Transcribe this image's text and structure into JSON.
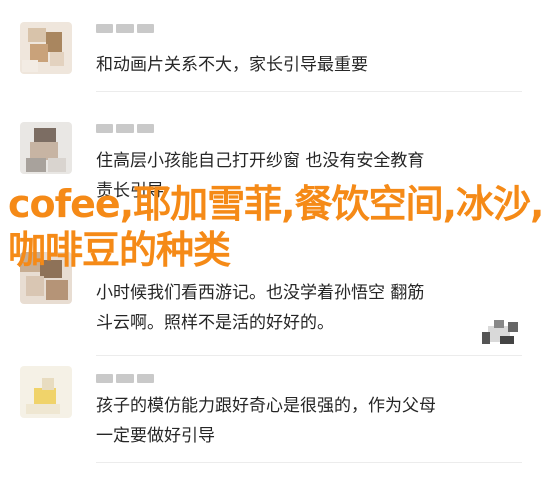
{
  "comments": [
    {
      "username_mask": "███",
      "lines": [
        "和动画片关系不大，家长引导最重要"
      ]
    },
    {
      "username_mask": "███",
      "lines": [
        "住高层小孩能自己打开纱窗 也没有安全教育",
        "责长引导"
      ]
    },
    {
      "username_mask": "███",
      "lines": [
        "小时候我们看西游记。也没学着孙悟空  翻筋",
        "斗云啊。照样不是活的好好的。"
      ]
    },
    {
      "username_mask": "███",
      "lines": [
        "孩子的模仿能力跟好奇心是很强的，作为父母",
        "一定要做好引导"
      ]
    }
  ],
  "overlay": {
    "title": "cofee,耶加雪菲,餐饮空间,冰沙,咖啡豆的种类"
  },
  "colors": {
    "overlay": "#f58a17",
    "divider": "#ececec",
    "text": "#262626"
  },
  "icons": [
    "avatar-image",
    "sticker-icon"
  ]
}
